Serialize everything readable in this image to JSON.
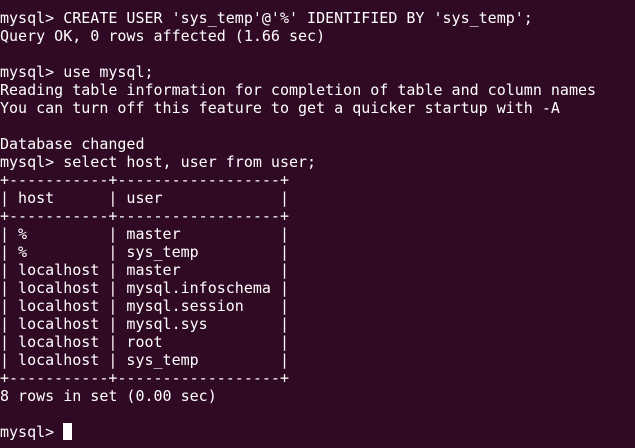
{
  "terminal": {
    "background": "#300a24",
    "foreground": "#ffffff",
    "lines": [
      "mysql> CREATE USER 'sys_temp'@'%' IDENTIFIED BY 'sys_temp';",
      "Query OK, 0 rows affected (1.66 sec)",
      "",
      "mysql> use mysql;",
      "Reading table information for completion of table and column names",
      "You can turn off this feature to get a quicker startup with -A",
      "",
      "Database changed",
      "mysql> select host, user from user;",
      "+-----------+------------------+",
      "| host      | user             |",
      "+-----------+------------------+",
      "| %         | master           |",
      "| %         | sys_temp         |",
      "| localhost | master           |",
      "| localhost | mysql.infoschema |",
      "| localhost | mysql.session    |",
      "| localhost | mysql.sys        |",
      "| localhost | root             |",
      "| localhost | sys_temp         |",
      "+-----------+------------------+",
      "8 rows in set (0.00 sec)",
      ""
    ],
    "prompt": "mysql> "
  }
}
